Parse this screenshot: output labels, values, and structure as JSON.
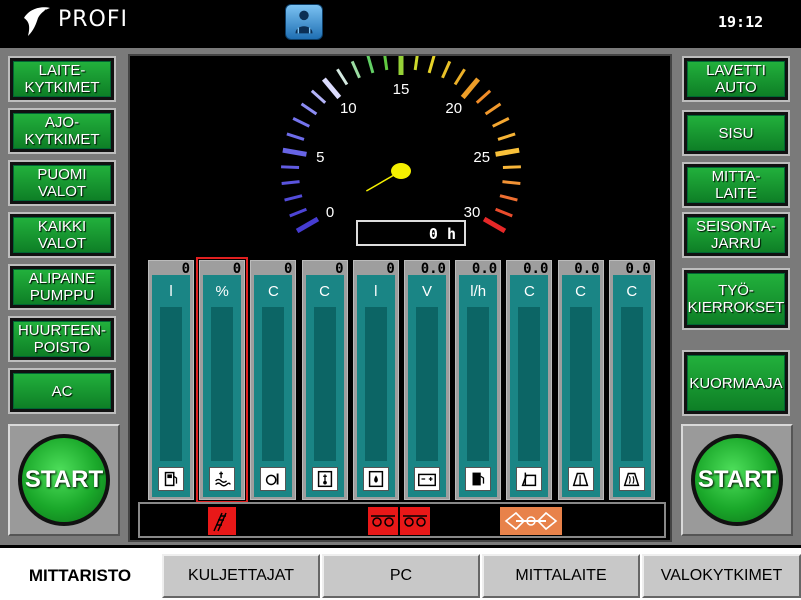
{
  "header": {
    "brand": "PROFI",
    "clock": "19:12",
    "operator_icon": "operator-person-icon"
  },
  "left_buttons": [
    {
      "label": "LAITE-\nKYTKIMET"
    },
    {
      "label": "AJO-\nKYTKIMET"
    },
    {
      "label": "PUOMI\nVALOT"
    },
    {
      "label": "KAIKKI\nVALOT"
    },
    {
      "label": "ALIPAINE\nPUMPPU"
    },
    {
      "label": "HUURTEEN-\nPOISTO"
    },
    {
      "label": "AC"
    }
  ],
  "right_buttons": [
    {
      "label": "LAVETTI\nAUTO"
    },
    {
      "label": "SISU"
    },
    {
      "label": "MITTA-\nLAITE"
    },
    {
      "label": "SEISONTA-\nJARRU"
    },
    {
      "label": "TYÖ-\nKIERROKSET"
    },
    {
      "label": "KUORMAAJA"
    }
  ],
  "start_left": "START",
  "start_right": "START",
  "gauge": {
    "min": 0,
    "max": 30,
    "value": 0,
    "labels": [
      "0",
      "5",
      "10",
      "15",
      "20",
      "25",
      "30"
    ],
    "hours": "0 h"
  },
  "meters": [
    {
      "value": "0",
      "unit": "l",
      "icon": "fuel-pump-icon",
      "level": 0
    },
    {
      "value": "0",
      "unit": "%",
      "icon": "coolant-level-icon",
      "level": 0
    },
    {
      "value": "0",
      "unit": "C",
      "icon": "engine-oil-temp-icon",
      "level": 0
    },
    {
      "value": "0",
      "unit": "C",
      "icon": "hydraulic-oil-temp-icon",
      "level": 0
    },
    {
      "value": "0",
      "unit": "l",
      "icon": "hydraulic-oil-level-icon",
      "level": 0
    },
    {
      "value": "0.0",
      "unit": "V",
      "icon": "battery-icon",
      "level": 0
    },
    {
      "value": "0.0",
      "unit": "l/h",
      "icon": "fuel-consumption-icon",
      "level": 0
    },
    {
      "value": "0.0",
      "unit": "C",
      "icon": "cabin-temp-icon",
      "level": 0
    },
    {
      "value": "0.0",
      "unit": "C",
      "icon": "outside-temp-icon",
      "level": 0
    },
    {
      "value": "0.0",
      "unit": "C",
      "icon": "window-heater-icon",
      "level": 0
    }
  ],
  "indicators": [
    {
      "name": "crane-warning-icon",
      "color": "#e81818"
    },
    {
      "name": "brake-warning-icon",
      "color": "#e81818"
    },
    {
      "name": "brake-warning-icon-2",
      "color": "#e81818"
    },
    {
      "name": "transmission-warning-icon",
      "color": "#e8824a"
    }
  ],
  "tabs": [
    {
      "label": "MITTARISTO",
      "active": true
    },
    {
      "label": "KULJETTAJAT",
      "active": false
    },
    {
      "label": "PC",
      "active": false
    },
    {
      "label": "MITTALAITE",
      "active": false
    },
    {
      "label": "VALOKYTKIMET",
      "active": false
    }
  ],
  "colors": {
    "button_green": "#1a9a33",
    "meter_teal": "#1a8585",
    "selection_red": "#e02020",
    "gauge_needle": "#f5f000"
  }
}
